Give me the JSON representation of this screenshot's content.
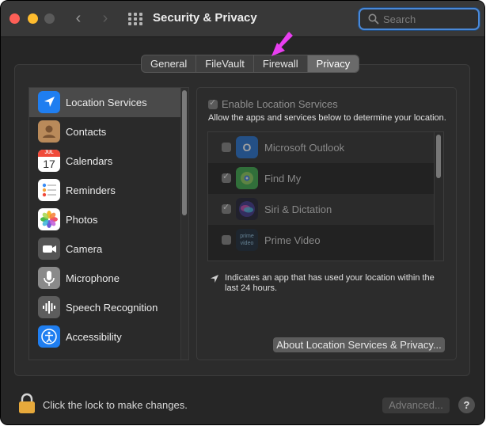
{
  "window": {
    "title": "Security & Privacy"
  },
  "search": {
    "placeholder": "Search"
  },
  "tabs": [
    {
      "label": "General",
      "active": false
    },
    {
      "label": "FileVault",
      "active": false
    },
    {
      "label": "Firewall",
      "active": false
    },
    {
      "label": "Privacy",
      "active": true
    }
  ],
  "sidebar": {
    "items": [
      {
        "label": "Location Services",
        "icon": "location-arrow-icon",
        "selected": true
      },
      {
        "label": "Contacts",
        "icon": "contacts-icon",
        "selected": false
      },
      {
        "label": "Calendars",
        "icon": "calendar-icon",
        "selected": false,
        "icon_month": "JUL",
        "icon_day": "17"
      },
      {
        "label": "Reminders",
        "icon": "reminders-icon",
        "selected": false
      },
      {
        "label": "Photos",
        "icon": "photos-icon",
        "selected": false
      },
      {
        "label": "Camera",
        "icon": "camera-icon",
        "selected": false
      },
      {
        "label": "Microphone",
        "icon": "microphone-icon",
        "selected": false
      },
      {
        "label": "Speech Recognition",
        "icon": "speech-recognition-icon",
        "selected": false
      },
      {
        "label": "Accessibility",
        "icon": "accessibility-icon",
        "selected": false
      }
    ]
  },
  "location": {
    "enable_label": "Enable Location Services",
    "enable_checked": true,
    "allow_text": "Allow the apps and services below to determine your location.",
    "apps": [
      {
        "name": "Microsoft Outlook",
        "checked": false,
        "icon": "outlook-icon",
        "icon_letter": "O"
      },
      {
        "name": "Find My",
        "checked": true,
        "icon": "find-my-icon"
      },
      {
        "name": "Siri & Dictation",
        "checked": true,
        "icon": "siri-icon"
      },
      {
        "name": "Prime Video",
        "checked": false,
        "icon": "prime-video-icon",
        "icon_text": "prime video"
      }
    ],
    "indicator_text": "Indicates an app that has used your location within the last 24 hours.",
    "about_button": "About Location Services & Privacy..."
  },
  "footer": {
    "lock_text": "Click the lock to make changes.",
    "advanced_button": "Advanced...",
    "help_button": "?"
  },
  "colors": {
    "window_bg": "#262626",
    "titlebar_bg": "#383838",
    "search_focus": "#4a89d8",
    "annotation_arrow": "#e83ff0",
    "lock_gold": "#e7a93b"
  }
}
